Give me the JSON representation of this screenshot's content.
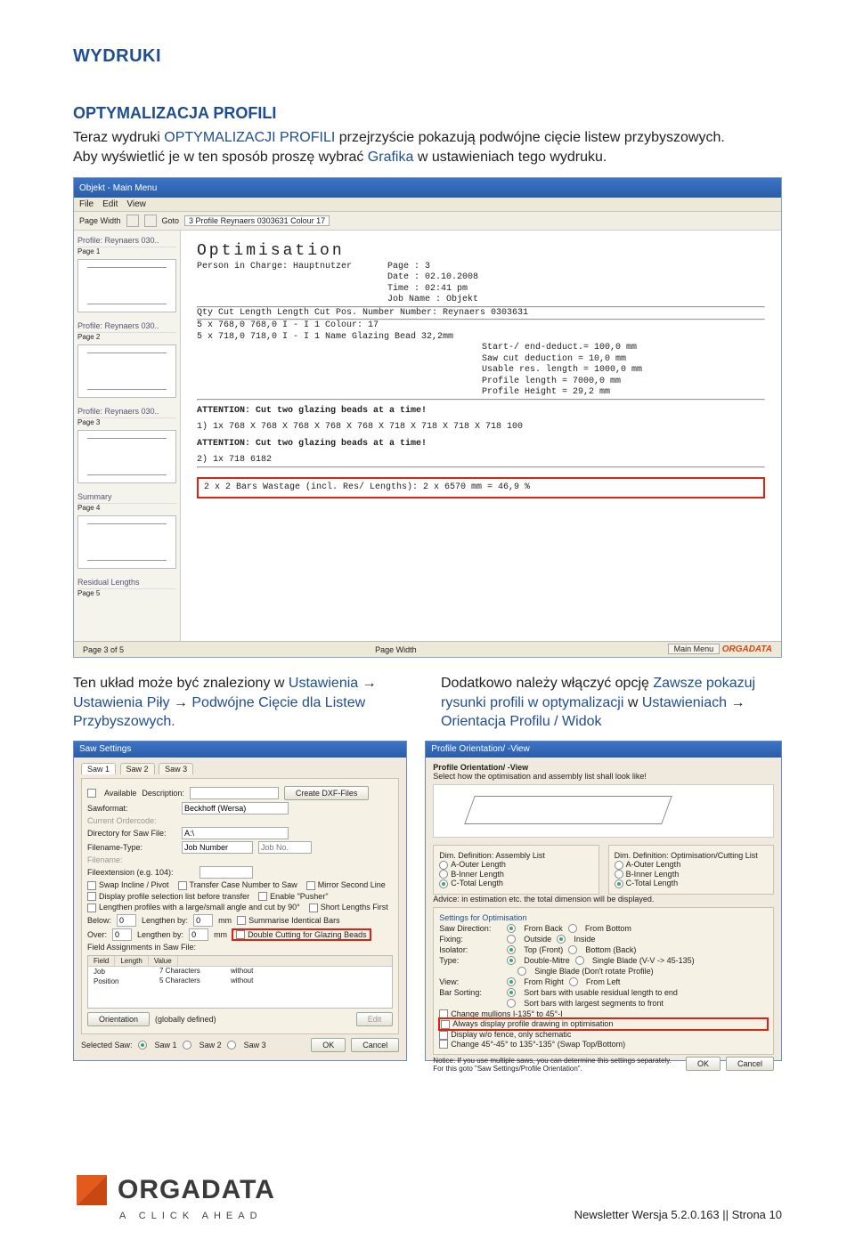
{
  "heading1": "WYDRUKI",
  "heading2": "OPTYMALIZACJA PROFILI",
  "intro_1a": "Teraz wydruki ",
  "intro_1b": "OPTYMALIZACJI PROFILI",
  "intro_1c": " przejrzyście pokazują podwójne cięcie listew przybyszowych.",
  "intro_2a": "Aby wyświetlić je w ten sposób proszę wybrać ",
  "intro_2b": "Grafika",
  "intro_2c": " w ustawieniach tego wydruku.",
  "screenshot": {
    "title": "Objekt - Main Menu",
    "menu": [
      "File",
      "Edit",
      "View"
    ],
    "toolbar": {
      "page_width_label": "Page Width",
      "goto_label": "Goto",
      "goto_value": "3 Profile Reynaers 0303631  Colour 17"
    },
    "left_panel": {
      "sec1": "Profile: Reynaers 030..",
      "page1": "Page 1",
      "sec2": "Profile: Reynaers 030..",
      "page2": "Page 2",
      "sec3": "Profile: Reynaers 030..",
      "page3": "Page 3",
      "sec4": "Summary",
      "page4": "Page 4",
      "sec5": "Residual Lengths",
      "page5": "Page 5"
    },
    "doc": {
      "title": "Optimisation",
      "person": "Person in Charge: Hauptnutzer",
      "meta": [
        "Page      : 3",
        "Date      : 02.10.2008",
        "Time      : 02:41 pm",
        "Job Name  : Objekt"
      ],
      "table_head": "Qty   Cut Length Length   Cut    Pos. Number   Number:       Reynaers 0303631",
      "rows": [
        " 5 x    768,0    768,0   I  -  I    1         Colour:                      17",
        " 5 x    718,0    718,0   I  -  I    1         Name        Glazing Bead 32,2mm"
      ],
      "details": [
        "Start-/ end-deduct.=  100,0 mm",
        "Saw cut deduction  =   10,0 mm",
        "Usable res. length = 1000,0 mm",
        "Profile length     = 7000,0 mm",
        "Profile Height     =   29,2 mm"
      ],
      "attn": "ATTENTION: Cut two glazing beads at a time!",
      "bar1": "1)  1x        768  X  768  X  768  X  768  X  768  X  718  X  718  X  718  X  718  100",
      "bar2": "2)  1x        718                                                          6182",
      "wastage": "2 x 2 Bars        Wastage (incl. Res/ Lengths):  2 x 6570 mm = 46,9 %"
    },
    "status": {
      "left": "Page 3 of 5",
      "mid": "Page Width",
      "right_btn": "Main Menu",
      "brand": "ORGADATA"
    }
  },
  "col_left": {
    "a": "Ten układ może być znaleziony w ",
    "b": "Ustawienia",
    "arrow": " → ",
    "c": "Ustawienia Piły",
    "d": "Podwójne Cięcie dla Listew Przybyszowych."
  },
  "col_right": {
    "a": "Dodatkowo należy włączyć opcję ",
    "b": "Zawsze pokazuj rysunki profili w optymalizacji",
    "c": " w ",
    "d": "Ustawieniach",
    "e": "Orientacja Profilu / Widok"
  },
  "dialog_left": {
    "title": "Saw Settings",
    "tabs": [
      "Saw 1",
      "Saw 2",
      "Saw 3"
    ],
    "available": "Available",
    "description": "Description:",
    "create_dxf": "Create DXF-Files",
    "sawformat": "Sawformat:",
    "sawformat_val": "Beckhoff (Wersa)",
    "ordercode": "Current Ordercode:",
    "directory": "Directory for Saw File:",
    "directory_val": "A:\\",
    "fnametype": "Filename-Type:",
    "fnametype_val": "Job Number",
    "jobno": "Job No.",
    "fname": "Filename:",
    "fileext": "Fileextension (e.g. 104):",
    "checks": [
      "Swap Incline / Pivot",
      "Transfer Case Number to Saw",
      "Mirror Second Line",
      "Display profile selection list before transfer",
      "Enable \"Pusher\"",
      "Lengthen profiles with a large/small angle and cut by 90°",
      "Short Lengths First",
      "Summarise Identical Bars"
    ],
    "below": "Below:",
    "lengthen_by": "Lengthen by:",
    "mm": "mm",
    "over": "Over:",
    "double_cut": "Double Cutting for Glazing Beads",
    "field_assign": "Field Assignments in Saw File:",
    "th_field": "Field",
    "th_len": "Length",
    "th_val": "Value",
    "row_job": "Job",
    "row_job_len": "7 Characters",
    "row_job_val": "without",
    "row_pos": "Position",
    "row_pos_len": "5 Characters",
    "row_pos_val": "without",
    "orientation_btn": "Orientation",
    "globally": "(globally defined)",
    "edit": "Edit",
    "selected_saw": "Selected Saw:",
    "saw1": "Saw 1",
    "saw2": "Saw 2",
    "saw3": "Saw 3",
    "ok": "OK",
    "cancel": "Cancel"
  },
  "dialog_right": {
    "title": "Profile Orientation/ -View",
    "heading": "Profile Orientation/ -View",
    "sub": "Select how the optimisation and assembly list shall look like!",
    "dim_asm": "Dim. Definition: Assembly List",
    "dim_cut": "Dim. Definition: Optimisation/Cutting List",
    "a_outer": "A-Outer Length",
    "b_inner": "B-Inner Length",
    "c_total": "C-Total Length",
    "advice": "Advice: in estimation etc. the total dimension will be displayed.",
    "settings_opt": "Settings for Optimisation",
    "saw_dir": "Saw Direction:",
    "from_back": "From Back",
    "from_bottom": "From Bottom",
    "fixing": "Fixing:",
    "outside": "Outside",
    "inside": "Inside",
    "isolator": "Isolator:",
    "top_front": "Top (Front)",
    "bottom_back": "Bottom (Back)",
    "type": "Type:",
    "double_mitre": "Double-Mitre",
    "single_vv": "Single Blade (V-V -> 45-135)",
    "single_dont": "Single Blade (Don't rotate Profile)",
    "view": "View:",
    "from_right": "From Right",
    "from_left": "From Left",
    "bar_sort": "Bar Sorting:",
    "sort1": "Sort bars with usable residual length to end",
    "sort2": "Sort bars with largest segments to front",
    "chg_mul": "Change mullions I-135° to 45°-I",
    "always_display": "Always display profile drawing in optimisation",
    "display_wo": "Display w/o fence, only schematic",
    "chg45": "Change 45°-45° to 135°-135° (Swap Top/Bottom)",
    "notice": "Notice: If you use multiple saws, you can determine this settings separately. For this goto \"Saw Settings/Profile Orientation\".",
    "ok": "OK",
    "cancel": "Cancel"
  },
  "footer": {
    "logo_text": "ORGADATA",
    "tagline": "A CLICK AHEAD",
    "page": "Newsletter Wersja 5.2.0.163 || Strona 10"
  }
}
